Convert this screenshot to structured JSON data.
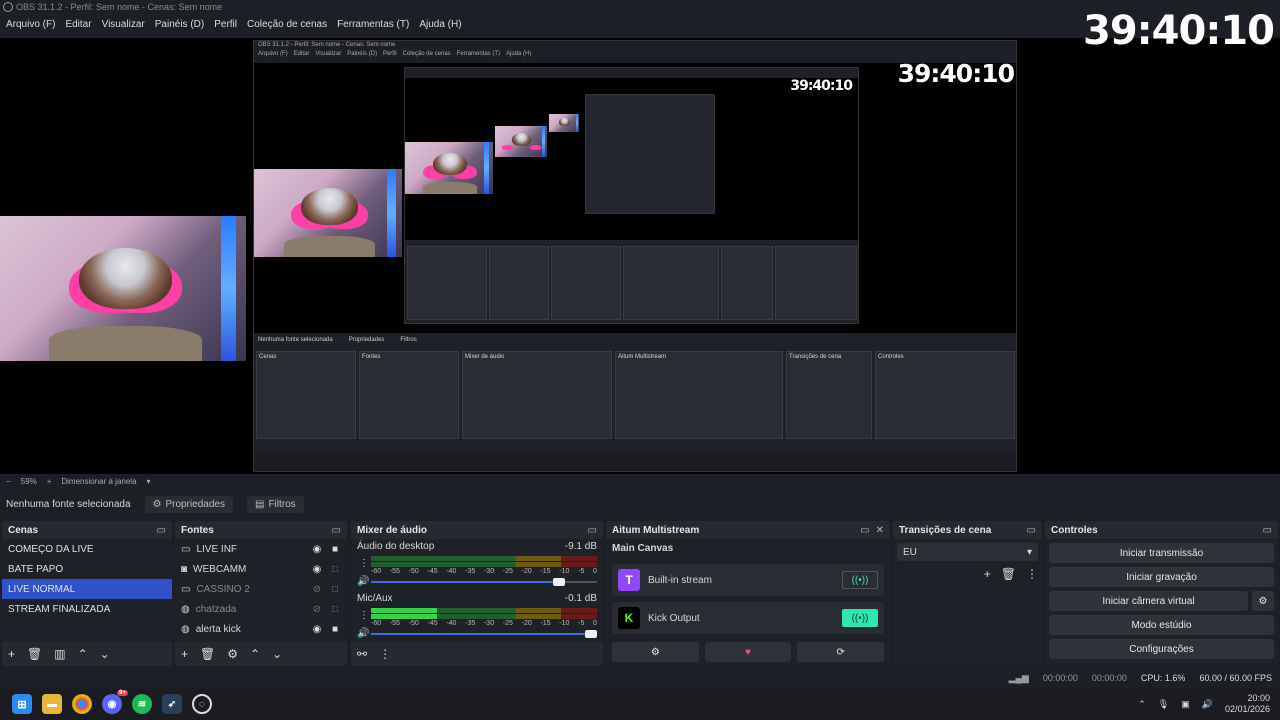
{
  "window": {
    "title": "OBS 31.1.2 - Perfil: Sem nome - Cenas: Sem nome"
  },
  "menu": [
    "Arquivo (F)",
    "Editar",
    "Visualizar",
    "Painéis (D)",
    "Perfil",
    "Coleção de cenas",
    "Ferramentas (T)",
    "Ajuda (H)"
  ],
  "preview": {
    "clock": "39:40:10",
    "zoom": "59%",
    "resize_mode": "Dimensionar à janela"
  },
  "source_toolbar": {
    "no_source": "Nenhuma fonte selecionada",
    "properties": "Propriedades",
    "filters": "Filtros"
  },
  "scenes": {
    "title": "Cenas",
    "items": [
      "COMEÇO DA LIVE",
      "BATE PAPO",
      "LIVE NORMAL",
      "STREAM FINALIZADA"
    ],
    "selected": "LIVE NORMAL"
  },
  "sources": {
    "title": "Fontes",
    "items": [
      {
        "name": "LIVE INF",
        "icon": "window-icon",
        "visible": true,
        "locked": true
      },
      {
        "name": "WEBCAMM",
        "icon": "camera-icon",
        "visible": true,
        "locked": false
      },
      {
        "name": "CASSINO 2",
        "icon": "window-icon",
        "visible": false,
        "locked": false
      },
      {
        "name": "chatzada",
        "icon": "browser-icon",
        "visible": false,
        "locked": false
      },
      {
        "name": "alerta kick",
        "icon": "browser-icon",
        "visible": true,
        "locked": true
      }
    ]
  },
  "mixer": {
    "title": "Mixer de áudio",
    "scale": [
      "-60",
      "-55",
      "-50",
      "-45",
      "-40",
      "-35",
      "-30",
      "-25",
      "-20",
      "-15",
      "-10",
      "-5",
      "0"
    ],
    "channels": [
      {
        "name": "Áudio do desktop",
        "db": "-9.1 dB",
        "level": 0,
        "volume": 0.86
      },
      {
        "name": "Mic/Aux",
        "db": "-0.1 dB",
        "level": 0.29,
        "volume": 1.0
      }
    ]
  },
  "multistream": {
    "title": "Aitum Multistream",
    "canvas": "Main Canvas",
    "outputs": [
      {
        "name": "Built-in stream",
        "platform": "twitch",
        "active": false,
        "color": "#9146ff"
      },
      {
        "name": "Kick Output",
        "platform": "kick",
        "active": true,
        "color": "#53fc18"
      }
    ]
  },
  "transitions": {
    "title": "Transições de cena",
    "selected": "EU"
  },
  "controls": {
    "title": "Controles",
    "buttons": [
      "Iniciar transmissão",
      "Iniciar gravação",
      "Iniciar câmera virtual",
      "Modo estúdio",
      "Configurações"
    ]
  },
  "status": {
    "stream_time": "00:00:00",
    "rec_time": "00:00:00",
    "cpu": "CPU: 1.6%",
    "fps": "60.00 / 60.00 FPS"
  },
  "taskbar": {
    "time": "20:00",
    "date": "02/01/2026",
    "discord_badge": "9+"
  },
  "nested": {
    "title": "OBS 31.1.2 - Perfil: Sem nome - Cenas: Sem nome",
    "menu": [
      "Arquivo (F)",
      "Editar",
      "Visualizar",
      "Painéis (D)",
      "Perfil",
      "Coleção de cenas",
      "Ferramentas (T)",
      "Ajuda (H)"
    ],
    "no_source": "Nenhuma fonte selecionada",
    "properties": "Propriedades",
    "filters": "Filtros",
    "docks": [
      "Cenas",
      "Fontes",
      "Mixer de áudio",
      "Aitum Multistream",
      "Transições de cena",
      "Controles"
    ]
  }
}
